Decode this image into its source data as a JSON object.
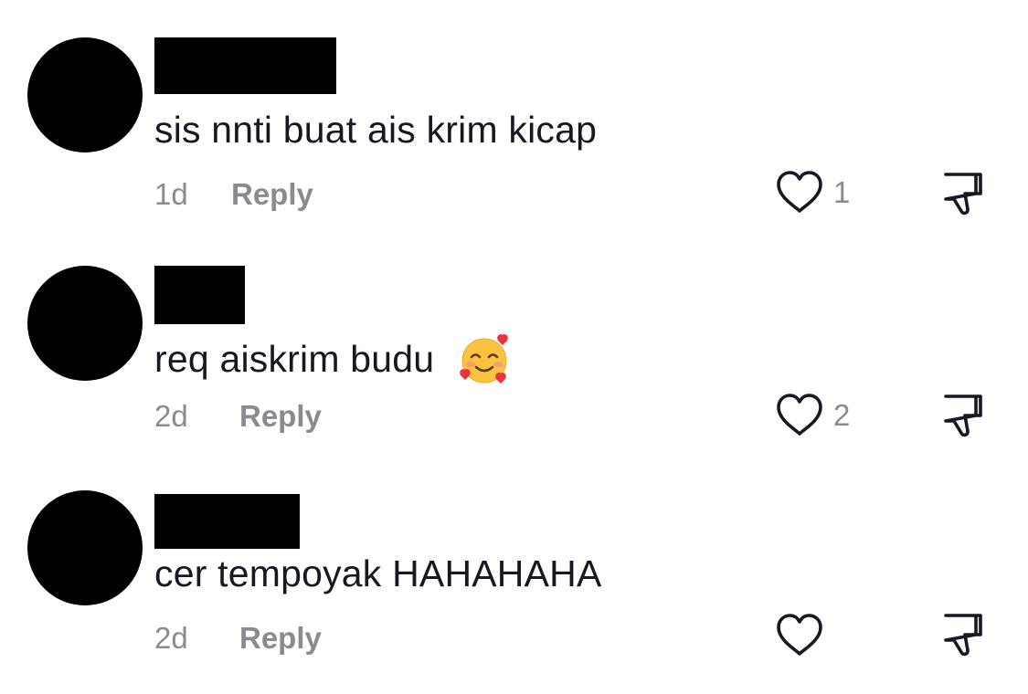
{
  "comments": [
    {
      "text": "sis nnti buat ais krim kicap",
      "time": "1d",
      "reply_label": "Reply",
      "likes": "1",
      "emoji": null
    },
    {
      "text": "req aiskrim budu",
      "time": "2d",
      "reply_label": "Reply",
      "likes": "2",
      "emoji": "smiling-face-with-hearts"
    },
    {
      "text": "cer tempoyak HAHAHAHA",
      "time": "2d",
      "reply_label": "Reply",
      "likes": "",
      "emoji": null
    }
  ],
  "icons": {
    "like": "heart-outline-icon",
    "dislike": "thumbs-down-icon"
  },
  "colors": {
    "text": "#161823",
    "meta": "#8a8b91",
    "redaction": "#000000"
  }
}
